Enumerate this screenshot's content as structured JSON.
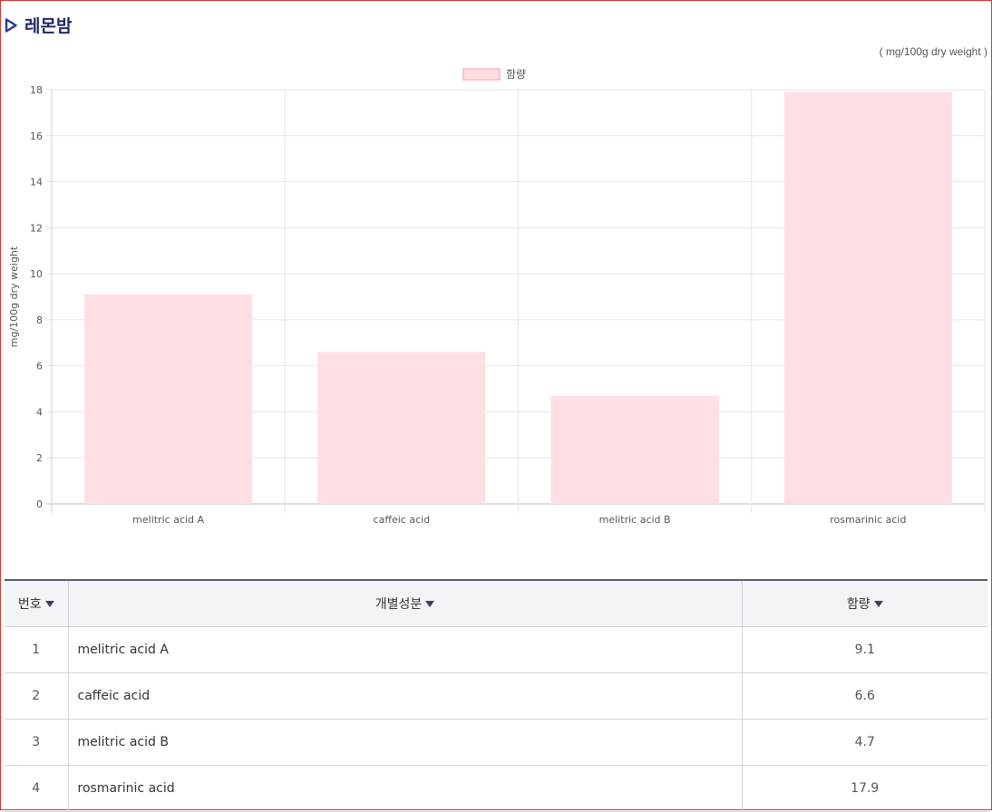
{
  "page": {
    "title": "레몬밤",
    "unit_note": "( mg/100g dry weight )",
    "accent_color": "#1f2a66",
    "icon": "play-triangle-icon"
  },
  "chart_data": {
    "type": "bar",
    "categories": [
      "melitric acid A",
      "caffeic acid",
      "melitric acid B",
      "rosmarinic acid"
    ],
    "series": [
      {
        "name": "함량",
        "values": [
          9.1,
          6.6,
          4.7,
          17.9
        ]
      }
    ],
    "ylabel": "mg/100g dry weight",
    "xlabel": "",
    "ylim": [
      0,
      18
    ],
    "yticks": [
      0,
      2,
      4,
      6,
      8,
      10,
      12,
      14,
      16,
      18
    ],
    "grid": true,
    "legend_position": "top-center",
    "bar_color": "#ffdee4",
    "bar_border_color": "#ffc2cd"
  },
  "table": {
    "headers": {
      "num": "번호",
      "name": "개별성분",
      "value": "함량"
    },
    "rows": [
      {
        "num": "1",
        "name": "melitric acid A",
        "value": "9.1"
      },
      {
        "num": "2",
        "name": "caffeic acid",
        "value": "6.6"
      },
      {
        "num": "3",
        "name": "melitric acid B",
        "value": "4.7"
      },
      {
        "num": "4",
        "name": "rosmarinic acid",
        "value": "17.9"
      }
    ]
  }
}
